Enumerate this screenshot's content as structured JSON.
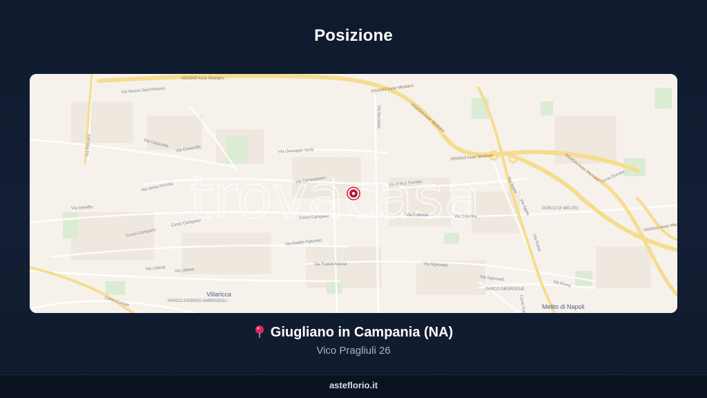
{
  "page": {
    "title": "Posizione",
    "footer": "asteflorio.it"
  },
  "location": {
    "city": "Giugliano in Campania (NA)",
    "address": "Vico Pragliuli 26",
    "pin_icon": "map-pin-icon"
  },
  "map": {
    "watermark": "trovacasa",
    "marker_icon": "location-marker-icon",
    "colors": {
      "land": "#f6f1ea",
      "highway": "#f6dc8e",
      "road": "#ffffff",
      "park": "#dcebd3",
      "marker": "#c0182e"
    },
    "labels": {
      "hw_top": "NSA543 Asse Mediano",
      "hw_mid": "NSA543 Asse Mediano",
      "hw_right": "NSA543 Asse Mediano",
      "hw_right_low": "NSA543 Asse Mediano",
      "hw_right_bottom": "NSA543 Asse Mediano",
      "via_nuova_sant_antonio": "Via Nuova Sant'Antonio",
      "via_ripuaria": "Via Ripuaria",
      "via_casacelle": "Via Casacelle",
      "via_cassacelle2": "Via Casacelle",
      "via_giuseppe_verdi": "Via Giuseppe Verdi",
      "via_campopiano": "Via Campopiano",
      "via_antica_giardini": "Via Antica Giardini",
      "via_selva_piccola": "Via Selva Piccola",
      "via_selva_piccola2": "Via Selva Piccola",
      "via_epitaffio": "Via Epitaffio",
      "corso_campano_left": "Corso Campano",
      "corso_campano_left2": "Corso Campano",
      "corso_campano": "Corso Campano",
      "via_colonne": "Via Colonne",
      "via_colonne2": "Via Colonne",
      "via_aniello_palumbo": "Via Aniello Palumbo",
      "via_fratelli_maristi": "Via Fratelli Maristi",
      "via_signorelli": "Via Signorelli",
      "via_signorelli2": "Via Signorelli",
      "via_libertà": "Via Libertà",
      "via_libertà2": "Via Libertà",
      "via_roma": "Via Roma",
      "via_roma2": "Via Roma",
      "via_roma3": "Via Roma",
      "corso_europa_left": "Corso Europa",
      "corso_europa_right": "Corso Europa",
      "corso_europa_bottom": "Corso Europa",
      "via_appia": "Via Appia",
      "via_appia2": "Via Appia",
      "via_seconda": "Via Seconda",
      "parco_giorgio": "PARCO GIORGIO AMBROSOLI",
      "parco_merolo": "PARCO DI MELITO",
      "parco_sbordone": "PARCO SBORDONE",
      "villaricca": "Villaricca",
      "melito": "Melito di Napoli"
    }
  }
}
